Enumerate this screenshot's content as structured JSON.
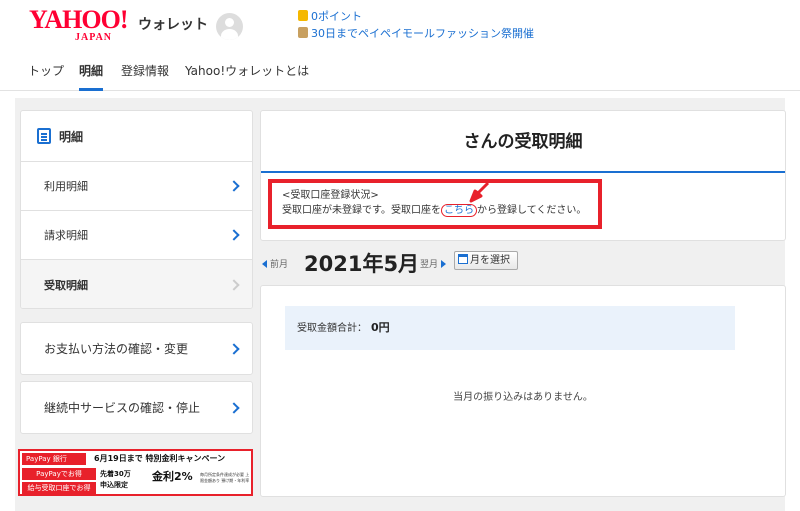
{
  "header": {
    "logo_main": "YAHOO!",
    "logo_sub": "JAPAN",
    "service_name": "ウォレット",
    "points_link": "0ポイント",
    "campaign_link": "30日までペイペイモールファッション祭開催"
  },
  "nav": {
    "tabs": [
      "トップ",
      "明細",
      "登録情報",
      "Yahoo!ウォレットとは"
    ],
    "active_tab": "明細"
  },
  "sidebar": {
    "heading": "明細",
    "items": [
      "利用明細",
      "請求明細",
      "受取明細"
    ],
    "current_item": "受取明細",
    "payment_method": "お支払い方法の確認・変更",
    "subscriptions": "継続中サービスの確認・停止"
  },
  "banner": {
    "brand": "PayPay 銀行",
    "title": "6月19日まで 特別金利キャンペーン",
    "pill_1": "PayPayでお得",
    "pill_2": "給与受取口座でお得",
    "line_1": "先着30万",
    "line_2": "申込限定",
    "rate_label": "金利2%",
    "note": "毎月所定条件達成が必要 上限金額あり 預け期・年利率"
  },
  "main": {
    "page_title": "さんの受取明細",
    "alert_heading": "<受取口座登録状況>",
    "alert_text_before": "受取口座が未登録です。受取口座を",
    "alert_link": "こちら",
    "alert_text_after": "から登録してください。",
    "prev_month": "前月",
    "month": "2021年5月",
    "next_month": "翌月",
    "select_month": "月を選択",
    "total_label": "受取金額合計：",
    "total_value": "0円",
    "empty_message": "当月の振り込みはありません。"
  },
  "colors": {
    "brand_red": "#ff0033",
    "link_blue": "#1a6fd1",
    "highlight_red": "#e8212b"
  }
}
